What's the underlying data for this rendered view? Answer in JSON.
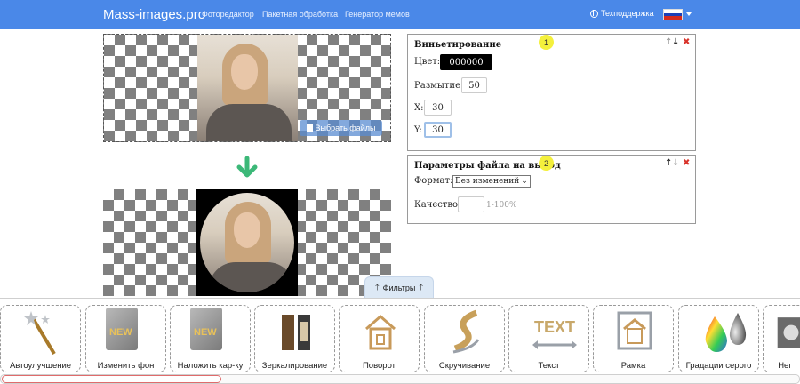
{
  "navbar": {
    "brand": "Mass-images.pro",
    "links": [
      "Фоторедактор",
      "Пакетная обработка",
      "Генератор мемов"
    ],
    "support": "Техподдержка"
  },
  "upload": {
    "choose_label": "Выбрать файлы"
  },
  "panel_vignette": {
    "title": "Виньетирование",
    "badge": "1",
    "color_label": "Цвет:",
    "color_value": "000000",
    "blur_label": "Размытие:",
    "blur_value": "50",
    "x_label": "X:",
    "x_value": "30",
    "y_label": "Y:",
    "y_value": "30"
  },
  "panel_output": {
    "title": "Параметры файла на выход",
    "badge": "2",
    "format_label": "Формат:",
    "format_value": "Без изменений",
    "quality_label": "Качество:",
    "quality_value": "",
    "quality_hint": "1-100%"
  },
  "filters_tab": "Фильтры",
  "tools": [
    {
      "label": "Автоулучшение",
      "icon": "magic-wand-icon"
    },
    {
      "label": "Изменить фон",
      "icon": "new-file-icon"
    },
    {
      "label": "Наложить кар-ку",
      "icon": "new-file-icon"
    },
    {
      "label": "Зеркалирование",
      "icon": "mirror-figure-icon"
    },
    {
      "label": "Поворот",
      "icon": "rotate-house-icon"
    },
    {
      "label": "Скручивание",
      "icon": "twist-icon"
    },
    {
      "label": "Текст",
      "icon": "text-icon"
    },
    {
      "label": "Рамка",
      "icon": "frame-house-icon"
    },
    {
      "label": "Градации серого",
      "icon": "color-drops-icon"
    },
    {
      "label": "Нег",
      "icon": "negative-icon"
    }
  ],
  "colors": {
    "navbar": "#4a88e8",
    "badge": "#f4f03c",
    "arrow": "#3cb878",
    "close": "#d9342b"
  }
}
